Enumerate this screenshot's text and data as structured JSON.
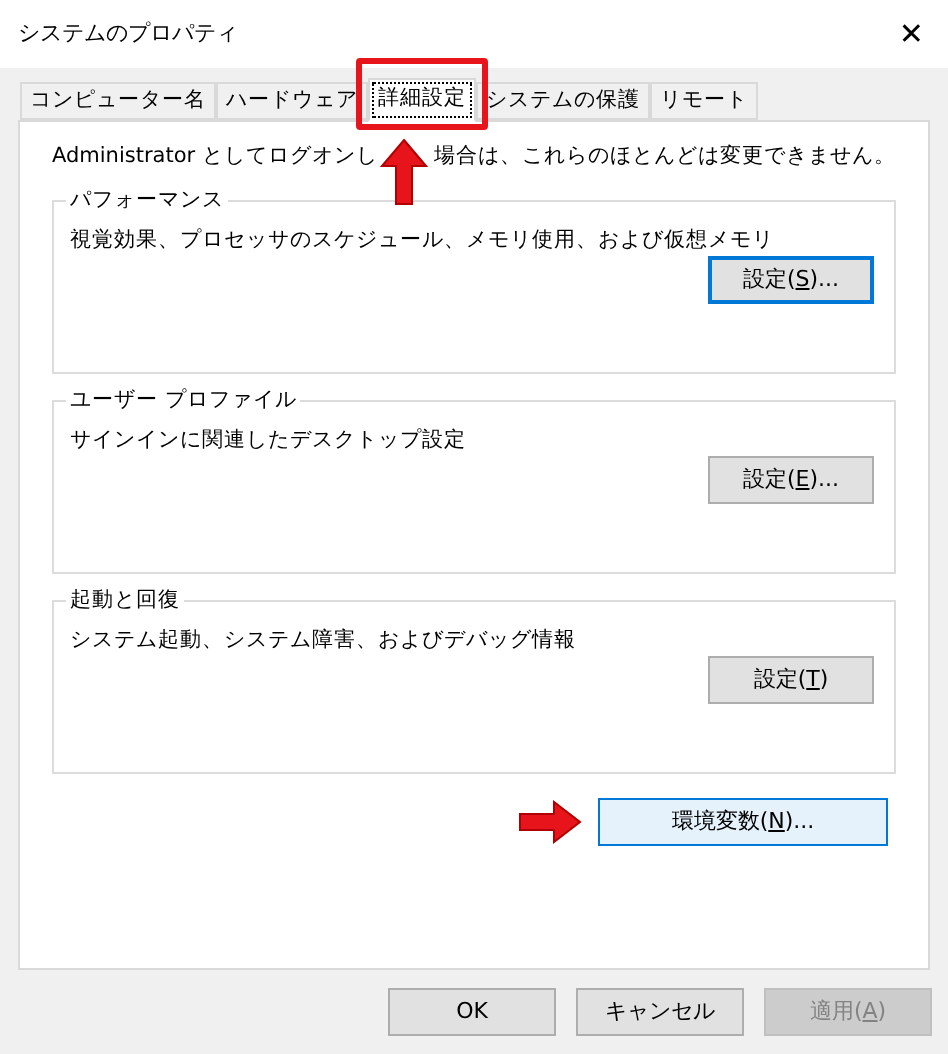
{
  "window": {
    "title": "システムのプロパティ",
    "close": "✕"
  },
  "tabs": [
    {
      "label": "コンピューター名",
      "selected": false
    },
    {
      "label": "ハードウェア",
      "selected": false
    },
    {
      "label": "詳細設定",
      "selected": true
    },
    {
      "label": "システムの保護",
      "selected": false
    },
    {
      "label": "リモート",
      "selected": false
    }
  ],
  "notice": {
    "before": "Administrator としてログオンし",
    "after": "場合は、これらのほとんどは変更できません。"
  },
  "groups": [
    {
      "title": "パフォーマンス",
      "description": "視覚効果、プロセッサのスケジュール、メモリ使用、および仮想メモリ",
      "button": {
        "before": "設定(",
        "key": "S",
        "after": ")...",
        "focused": true,
        "hot": false,
        "disabled": false
      }
    },
    {
      "title": "ユーザー プロファイル",
      "description": "サインインに関連したデスクトップ設定",
      "button": {
        "before": "設定(",
        "key": "E",
        "after": ")...",
        "focused": false,
        "hot": false,
        "disabled": false
      }
    },
    {
      "title": "起動と回復",
      "description": "システム起動、システム障害、およびデバッグ情報",
      "button": {
        "before": "設定(",
        "key": "T",
        "after": ")",
        "focused": false,
        "hot": false,
        "disabled": false
      }
    }
  ],
  "env_button": {
    "before": "環境変数(",
    "key": "N",
    "after": ")...",
    "focused": false,
    "hot": true,
    "disabled": false
  },
  "footer_buttons": [
    {
      "before": "OK",
      "focused": false,
      "hot": false,
      "disabled": false
    },
    {
      "before": "キャンセル",
      "focused": false,
      "hot": false,
      "disabled": false
    },
    {
      "before": "適用(",
      "key": "A",
      "after": ")",
      "focused": false,
      "hot": false,
      "disabled": true
    }
  ]
}
